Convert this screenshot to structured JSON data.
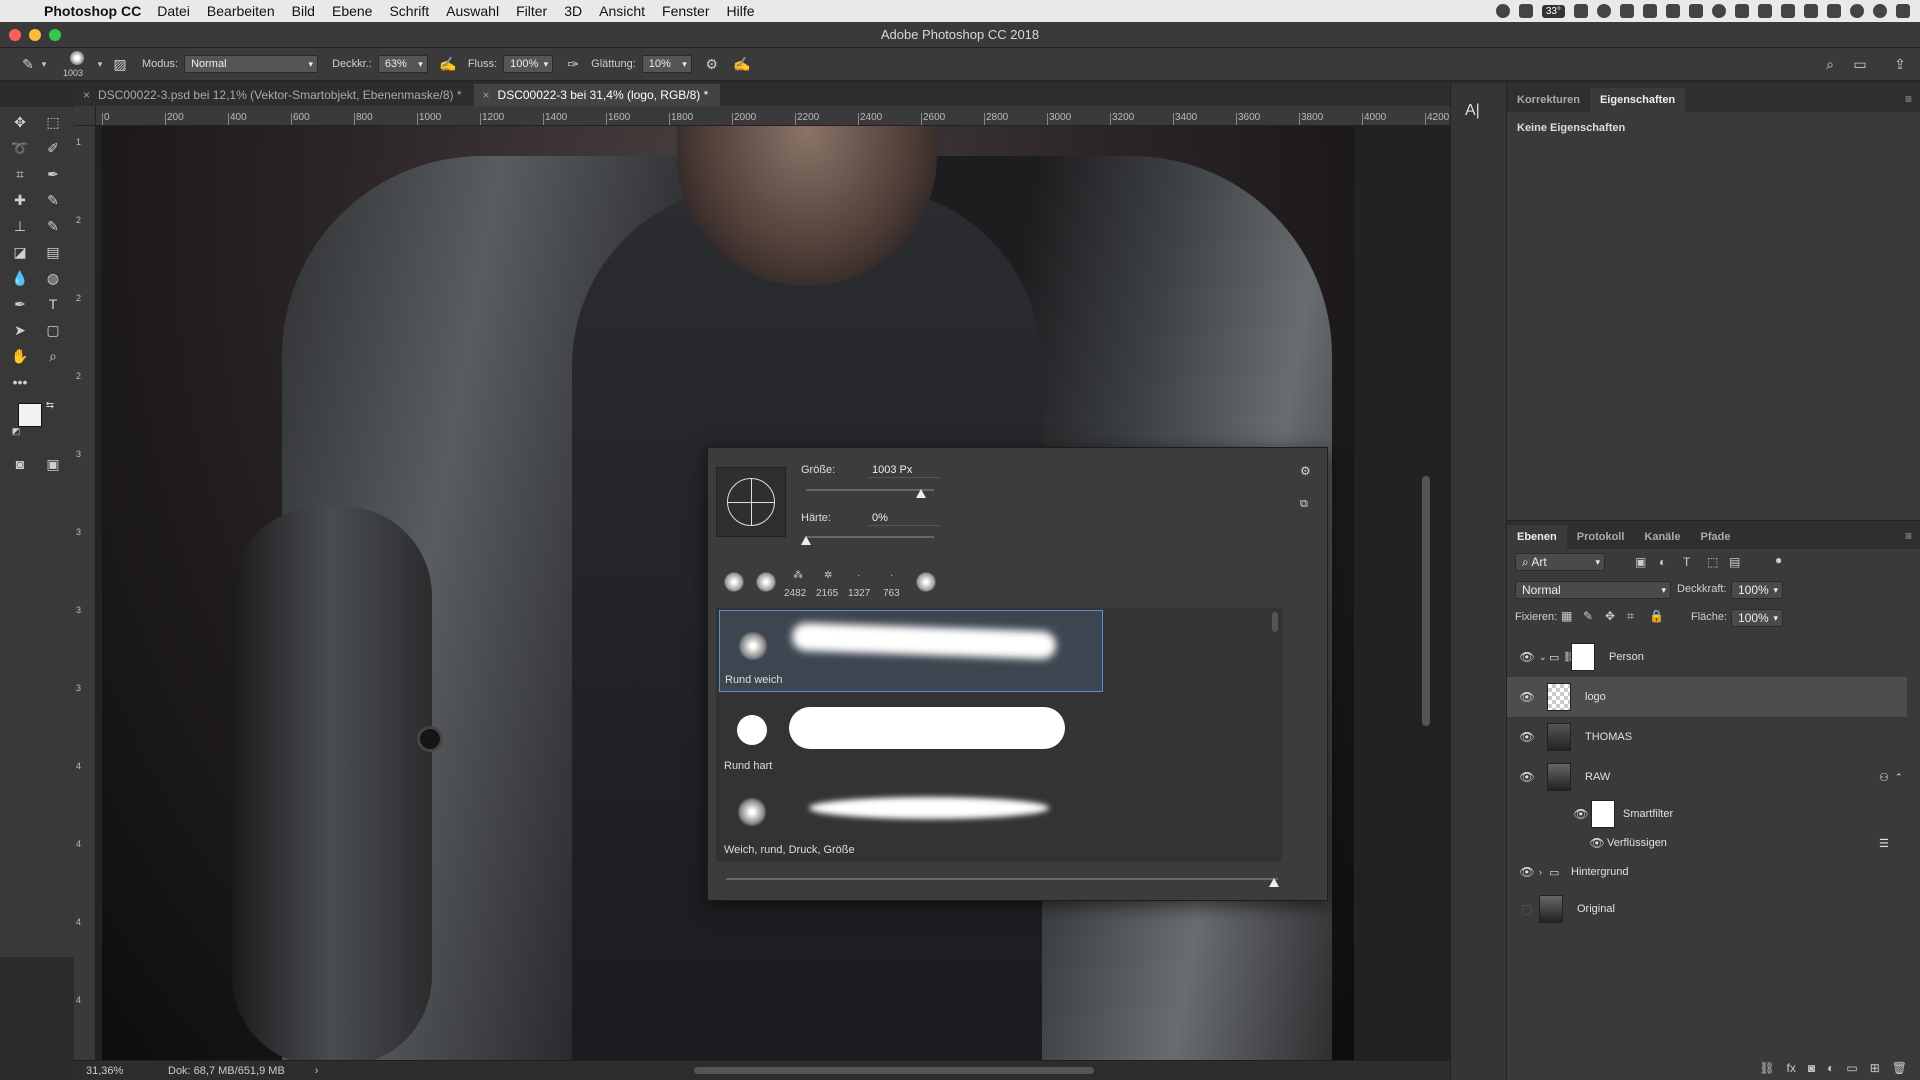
{
  "menubar": {
    "app": "Photoshop CC",
    "items": [
      "Datei",
      "Bearbeiten",
      "Bild",
      "Ebene",
      "Schrift",
      "Auswahl",
      "Filter",
      "3D",
      "Ansicht",
      "Fenster",
      "Hilfe"
    ],
    "battery_badge": "33°"
  },
  "window": {
    "title": "Adobe Photoshop CC 2018"
  },
  "options": {
    "brush_size": "1003",
    "mode_label": "Modus:",
    "mode_value": "Normal",
    "opacity_label": "Deckkr.:",
    "opacity_value": "63%",
    "flow_label": "Fluss:",
    "flow_value": "100%",
    "smoothing_label": "Glättung:",
    "smoothing_value": "10%"
  },
  "tabs": [
    {
      "label": "DSC00022-3.psd bei 12,1% (Vektor-Smartobjekt, Ebenenmaske/8) *"
    },
    {
      "label": "DSC00022-3 bei 31,4% (logo, RGB/8) *"
    }
  ],
  "ruler": {
    "h": [
      "0",
      "200",
      "400",
      "600",
      "800",
      "1000",
      "1200",
      "1400",
      "1600",
      "1800",
      "2000",
      "2200",
      "2400",
      "2600",
      "2800",
      "3000",
      "3200",
      "3400",
      "3600",
      "3800",
      "4000",
      "4200"
    ],
    "v": [
      "1",
      "2",
      "2",
      "2",
      "3",
      "3",
      "3",
      "3",
      "4",
      "4",
      "4",
      "4"
    ]
  },
  "status": {
    "zoom": "31,36%",
    "doc": "Dok: 68,7 MB/651,9 MB"
  },
  "brush_popup": {
    "size_label": "Größe:",
    "size_value": "1003 Px",
    "size_fraction": 0.9,
    "hardness_label": "Härte:",
    "hardness_value": "0%",
    "hardness_fraction": 0.0,
    "preset_numbers": [
      "2482",
      "2165",
      "1327",
      "763"
    ],
    "brushes": [
      {
        "name": "Rund weich"
      },
      {
        "name": "Rund hart"
      },
      {
        "name": "Weich, rund, Druck, Größe"
      }
    ]
  },
  "properties": {
    "tabs": [
      "Korrekturen",
      "Eigenschaften"
    ],
    "empty_text": "Keine Eigenschaften"
  },
  "layers": {
    "tabs": [
      "Ebenen",
      "Protokoll",
      "Kanäle",
      "Pfade"
    ],
    "filter_kind": "Art",
    "blend_mode": "Normal",
    "opacity_label": "Deckkraft:",
    "opacity_value": "100%",
    "lock_label": "Fixieren:",
    "fill_label": "Fläche:",
    "fill_value": "100%",
    "items": [
      {
        "name": "Person"
      },
      {
        "name": "logo"
      },
      {
        "name": "THOMAS"
      },
      {
        "name": "RAW"
      },
      {
        "name": "Smartfilter"
      },
      {
        "name": "Verflüssigen"
      },
      {
        "name": "Hintergrund"
      },
      {
        "name": "Original"
      }
    ]
  },
  "colors": {
    "selection": "#5b8fd3",
    "panel": "#3a3a3a",
    "accent_bg": "#4d4d4d"
  }
}
